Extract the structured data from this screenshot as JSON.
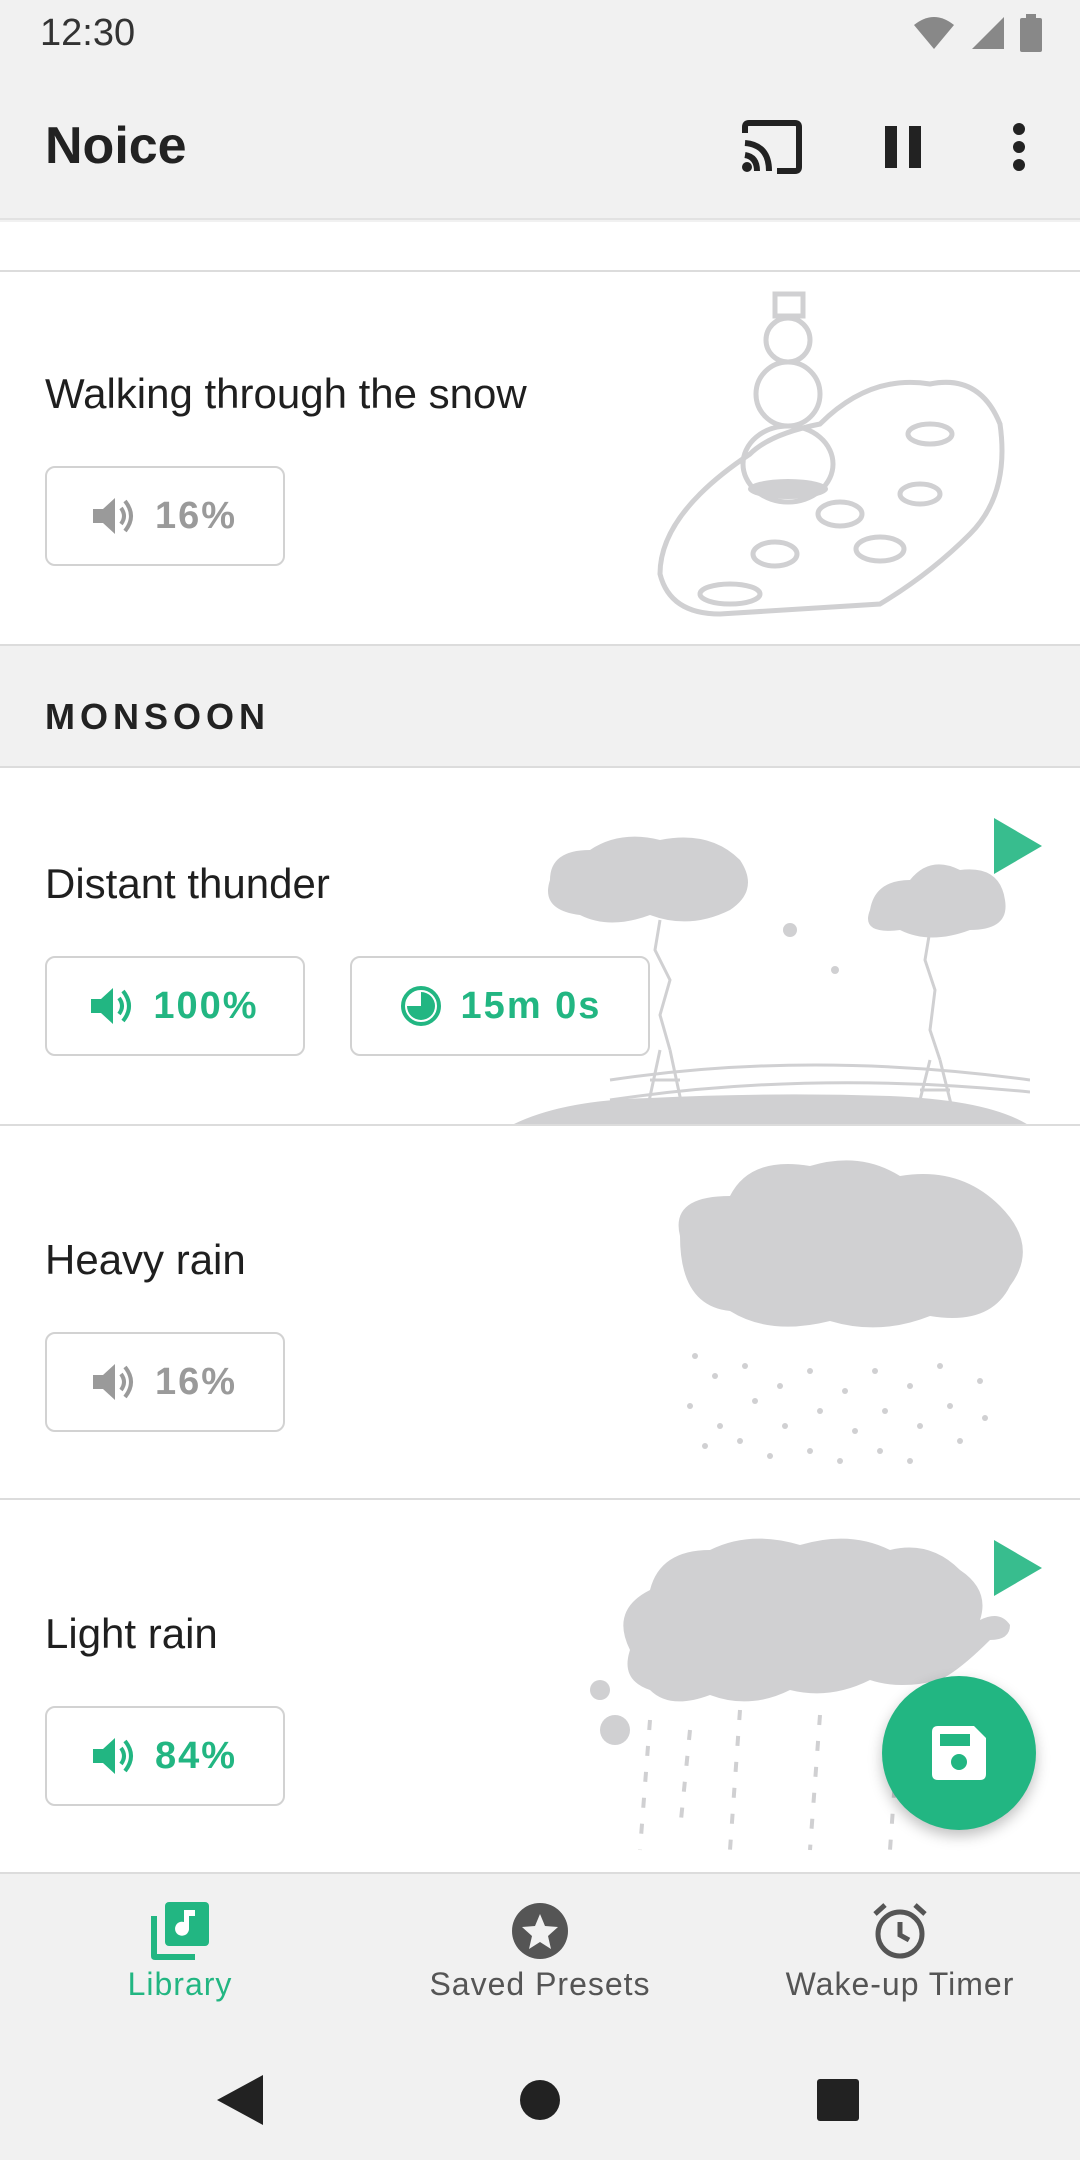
{
  "status_bar": {
    "time": "12:30",
    "icons": [
      "wifi-icon",
      "signal-icon",
      "battery-icon"
    ]
  },
  "app_bar": {
    "title": "Noice",
    "actions": [
      "cast-icon",
      "pause-icon",
      "more-vert-icon"
    ]
  },
  "sounds_top": [
    {
      "title": "Walking through the snow",
      "volume": "16%",
      "active": false,
      "art": "snowman-illustration"
    }
  ],
  "section": {
    "label": "MONSOON"
  },
  "sounds": [
    {
      "title": "Distant thunder",
      "volume": "100%",
      "timer": "15m 0s",
      "active": true,
      "playing_indicator": true,
      "art": "thunder-illustration"
    },
    {
      "title": "Heavy rain",
      "volume": "16%",
      "active": false,
      "art": "heavy-rain-illustration"
    },
    {
      "title": "Light rain",
      "volume": "84%",
      "active": true,
      "playing_indicator": true,
      "art": "light-rain-illustration"
    }
  ],
  "fab": {
    "icon": "save-icon"
  },
  "bottom_nav": [
    {
      "label": "Library",
      "icon": "library-music-icon",
      "selected": true
    },
    {
      "label": "Saved Presets",
      "icon": "star-circle-icon",
      "selected": false
    },
    {
      "label": "Wake-up Timer",
      "icon": "alarm-icon",
      "selected": false
    }
  ],
  "system_nav": [
    "back-icon",
    "home-icon",
    "recents-icon"
  ],
  "colors": {
    "accent": "#22b682",
    "inactive": "#9a9a9a",
    "art_gray": "#d0d0d2",
    "background": "#f1f1f1"
  }
}
